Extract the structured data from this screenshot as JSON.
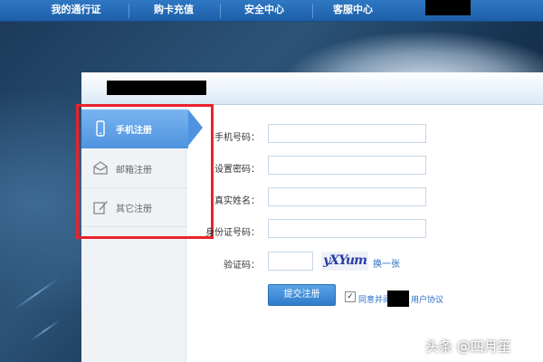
{
  "nav": {
    "items": [
      {
        "label": "我的通行证"
      },
      {
        "label": "购卡充值"
      },
      {
        "label": "安全中心"
      },
      {
        "label": "客服中心"
      }
    ]
  },
  "sidebar": {
    "items": [
      {
        "label": "手机注册",
        "icon": "phone-icon",
        "active": true
      },
      {
        "label": "邮箱注册",
        "icon": "envelope-icon",
        "active": false
      },
      {
        "label": "其它注册",
        "icon": "edit-icon",
        "active": false
      }
    ]
  },
  "form": {
    "phone_label": "手机号码：",
    "password_label": "设置密码：",
    "realname_label": "真实姓名：",
    "idcard_label": "身份证号码：",
    "captcha_label": "验证码：",
    "captcha_text": "yXYum",
    "refresh_label": "换一张",
    "submit_label": "提交注册",
    "agree_text_before": "同意并阅",
    "agree_text_after": "用户协议"
  },
  "colors": {
    "accent": "#4f93e0",
    "highlight_border": "#e8232b",
    "nav_bg": "#1d5fa8"
  },
  "watermark": "头条 @四月笙"
}
